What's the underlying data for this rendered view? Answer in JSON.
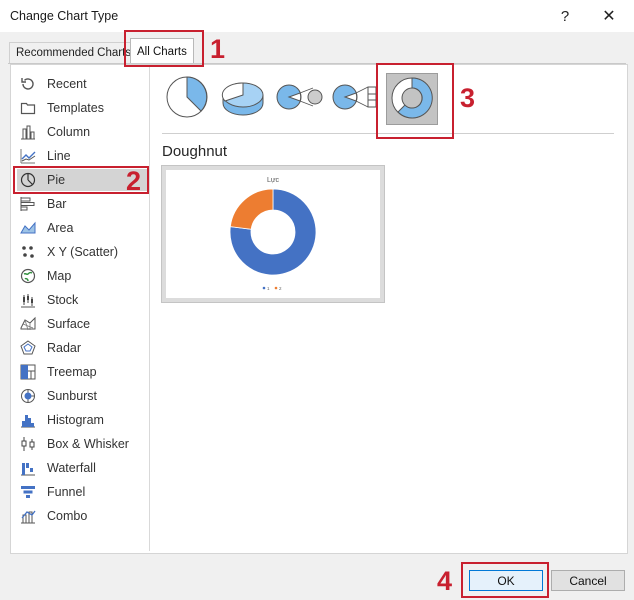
{
  "window": {
    "title": "Change Chart Type",
    "help": "?",
    "close": "✕"
  },
  "tabs": [
    {
      "label": "Recommended Charts"
    },
    {
      "label": "All Charts"
    }
  ],
  "sidebar": {
    "items": [
      {
        "label": "Recent",
        "icon": "recent-icon"
      },
      {
        "label": "Templates",
        "icon": "templates-icon"
      },
      {
        "label": "Column",
        "icon": "column-chart-icon"
      },
      {
        "label": "Line",
        "icon": "line-chart-icon"
      },
      {
        "label": "Pie",
        "icon": "pie-chart-icon"
      },
      {
        "label": "Bar",
        "icon": "bar-chart-icon"
      },
      {
        "label": "Area",
        "icon": "area-chart-icon"
      },
      {
        "label": "X Y (Scatter)",
        "icon": "scatter-chart-icon"
      },
      {
        "label": "Map",
        "icon": "map-chart-icon"
      },
      {
        "label": "Stock",
        "icon": "stock-chart-icon"
      },
      {
        "label": "Surface",
        "icon": "surface-chart-icon"
      },
      {
        "label": "Radar",
        "icon": "radar-chart-icon"
      },
      {
        "label": "Treemap",
        "icon": "treemap-chart-icon"
      },
      {
        "label": "Sunburst",
        "icon": "sunburst-chart-icon"
      },
      {
        "label": "Histogram",
        "icon": "histogram-chart-icon"
      },
      {
        "label": "Box & Whisker",
        "icon": "box-whisker-chart-icon"
      },
      {
        "label": "Waterfall",
        "icon": "waterfall-chart-icon"
      },
      {
        "label": "Funnel",
        "icon": "funnel-chart-icon"
      },
      {
        "label": "Combo",
        "icon": "combo-chart-icon"
      }
    ],
    "selected": "Pie"
  },
  "subtypes": [
    {
      "icon": "pie-subtype-icon"
    },
    {
      "icon": "3d-pie-subtype-icon"
    },
    {
      "icon": "pie-of-pie-subtype-icon"
    },
    {
      "icon": "bar-of-pie-subtype-icon"
    },
    {
      "icon": "doughnut-subtype-icon",
      "selected": true
    }
  ],
  "selected_chart_name": "Doughnut",
  "preview": {
    "chart_title": "Lực",
    "legend": [
      "1",
      "2"
    ],
    "colors": {
      "series1": "#4472c4",
      "series2": "#ed7d31"
    }
  },
  "chart_data": {
    "type": "pie",
    "title": "Lực",
    "categories": [
      "1",
      "2"
    ],
    "values": [
      77,
      23
    ],
    "hole": true,
    "legend": "bottom"
  },
  "annotations": [
    "1",
    "2",
    "3",
    "4"
  ],
  "buttons": {
    "ok": "OK",
    "cancel": "Cancel"
  },
  "colors": {
    "accent": "#0078d7",
    "annotation": "#c8202f"
  }
}
